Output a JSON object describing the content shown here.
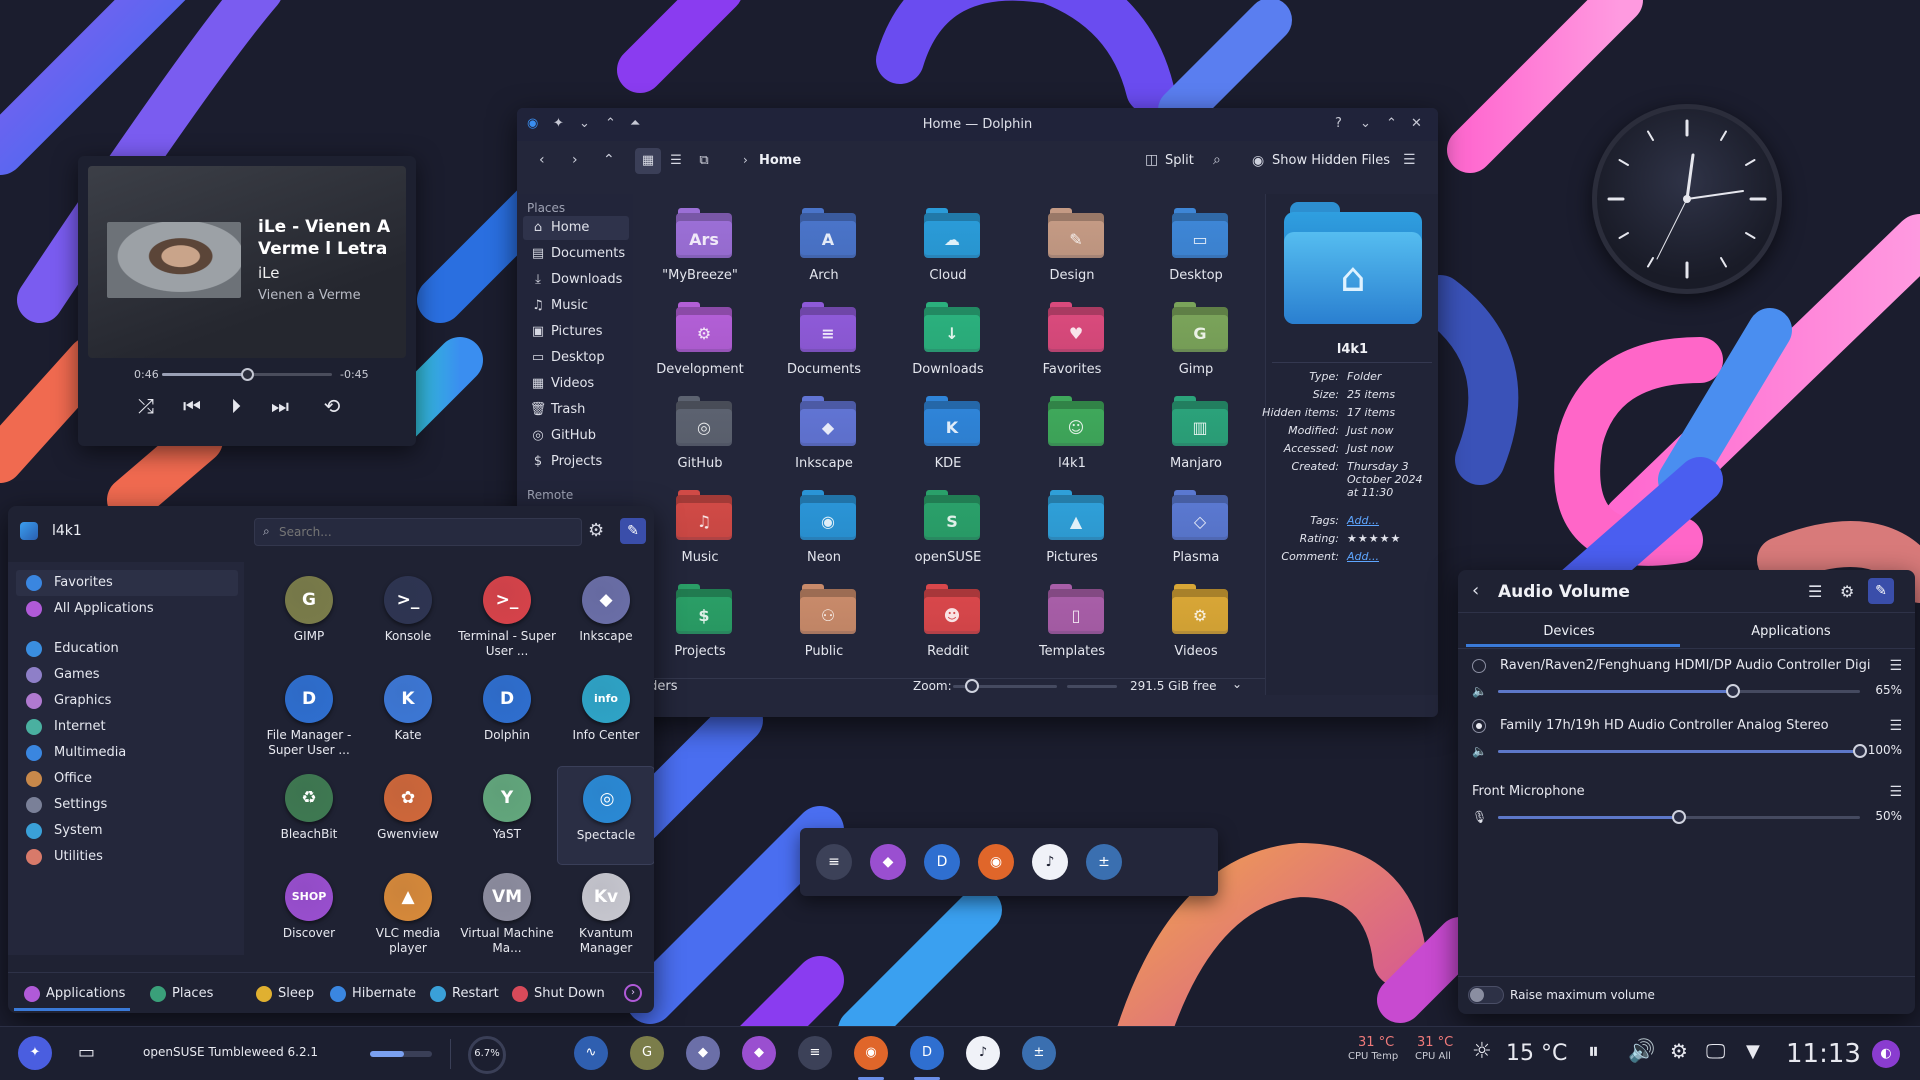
{
  "media_player": {
    "title": "iLe - Vienen A Verme l Letra",
    "artist": "iLe",
    "album": "Vienen a Verme",
    "elapsed": "0:46",
    "remaining": "-0:45",
    "progress": 0.5,
    "controls": [
      "shuffle-icon",
      "previous-icon",
      "play-icon",
      "next-icon",
      "repeat-icon"
    ]
  },
  "dolphin": {
    "window_title": "Home — Dolphin",
    "breadcrumb": "Home",
    "split_label": "Split",
    "show_hidden_label": "Show Hidden Files",
    "places_header": "Places",
    "remote_header": "Remote",
    "places": [
      {
        "label": "Home",
        "icon": "home-icon"
      },
      {
        "label": "Documents",
        "icon": "document-icon"
      },
      {
        "label": "Downloads",
        "icon": "download-icon"
      },
      {
        "label": "Music",
        "icon": "music-icon"
      },
      {
        "label": "Pictures",
        "icon": "picture-icon"
      },
      {
        "label": "Desktop",
        "icon": "desktop-icon"
      },
      {
        "label": "Videos",
        "icon": "video-icon"
      },
      {
        "label": "Trash",
        "icon": "trash-icon"
      },
      {
        "label": "GitHub",
        "icon": "github-icon"
      },
      {
        "label": "Projects",
        "icon": "dollar-icon"
      }
    ],
    "folders": [
      {
        "name": "\"MyBreeze\"",
        "color": "#9b6fd6",
        "glyph": "Ars"
      },
      {
        "name": "Arch",
        "color": "#4a74c9",
        "glyph": "A"
      },
      {
        "name": "Cloud",
        "color": "#2a9bd8",
        "glyph": "☁"
      },
      {
        "name": "Design",
        "color": "#c49a84",
        "glyph": "✎"
      },
      {
        "name": "Desktop",
        "color": "#3e86d6",
        "glyph": "▭"
      },
      {
        "name": "Development",
        "color": "#b25fd6",
        "glyph": "⚙"
      },
      {
        "name": "Documents",
        "color": "#8e5ad8",
        "glyph": "≡"
      },
      {
        "name": "Downloads",
        "color": "#2bb07d",
        "glyph": "↓"
      },
      {
        "name": "Favorites",
        "color": "#d94a7c",
        "glyph": "♥"
      },
      {
        "name": "Gimp",
        "color": "#7aa35a",
        "glyph": "G"
      },
      {
        "name": "GitHub",
        "color": "#5c6270",
        "glyph": "◎"
      },
      {
        "name": "Inkscape",
        "color": "#6174d3",
        "glyph": "◆"
      },
      {
        "name": "KDE",
        "color": "#2f84d8",
        "glyph": "K"
      },
      {
        "name": "l4k1",
        "color": "#3fa85b",
        "glyph": "☺"
      },
      {
        "name": "Manjaro",
        "color": "#2ba27a",
        "glyph": "▥"
      },
      {
        "name": "Music",
        "color": "#d04a46",
        "glyph": "♫"
      },
      {
        "name": "Neon",
        "color": "#2a94d6",
        "glyph": "◉"
      },
      {
        "name": "openSUSE",
        "color": "#2aa06a",
        "glyph": "S"
      },
      {
        "name": "Pictures",
        "color": "#2f9fd8",
        "glyph": "▲"
      },
      {
        "name": "Plasma",
        "color": "#5a78d0",
        "glyph": "◇"
      },
      {
        "name": "Projects",
        "color": "#2a9e66",
        "glyph": "$"
      },
      {
        "name": "Public",
        "color": "#c88a6a",
        "glyph": "⚇"
      },
      {
        "name": "Reddit",
        "color": "#d8474b",
        "glyph": "☻"
      },
      {
        "name": "Templates",
        "color": "#a85ea8",
        "glyph": "▯"
      },
      {
        "name": "Videos",
        "color": "#d8a636",
        "glyph": "⚙"
      }
    ],
    "status": {
      "folders": "folders",
      "zoom_label": "Zoom:",
      "zoom_level": 0.18,
      "free_space": "291.5 GiB free"
    },
    "info_panel": {
      "name": "l4k1",
      "rows": [
        {
          "key": "Type:",
          "value": "Folder"
        },
        {
          "key": "Size:",
          "value": "25 items"
        },
        {
          "key": "Hidden items:",
          "value": "17 items"
        },
        {
          "key": "Modified:",
          "value": "Just now"
        },
        {
          "key": "Accessed:",
          "value": "Just now"
        },
        {
          "key": "Created:",
          "value": "Thursday 3 October 2024 at 11:30"
        },
        {
          "key": "Tags:",
          "value": "Add..."
        },
        {
          "key": "Rating:",
          "value": "★★★★★"
        },
        {
          "key": "Comment:",
          "value": "Add..."
        }
      ]
    }
  },
  "launcher": {
    "user": "l4k1",
    "search_placeholder": "Search...",
    "categories": [
      {
        "label": "Favorites",
        "color": "#3a86e0"
      },
      {
        "label": "All Applications",
        "color": "#b05ad8"
      },
      {
        "label": "Education",
        "color": "#3a8ee0"
      },
      {
        "label": "Games",
        "color": "#8e7fc8"
      },
      {
        "label": "Graphics",
        "color": "#b07ad0"
      },
      {
        "label": "Internet",
        "color": "#4ab0a0"
      },
      {
        "label": "Multimedia",
        "color": "#3a86e0"
      },
      {
        "label": "Office",
        "color": "#c8884a"
      },
      {
        "label": "Settings",
        "color": "#7a8098"
      },
      {
        "label": "System",
        "color": "#3aa0d8"
      },
      {
        "label": "Utilities",
        "color": "#d87a6a"
      }
    ],
    "apps": [
      {
        "name": "GIMP",
        "color": "#7b7d4a",
        "glyph": "G"
      },
      {
        "name": "Konsole",
        "color": "#2e3552",
        "glyph": ">_"
      },
      {
        "name": "Terminal - Super User ...",
        "color": "#d8434a",
        "glyph": ">_"
      },
      {
        "name": "Inkscape",
        "color": "#6b6fa8",
        "glyph": "◆"
      },
      {
        "name": "File Manager - Super User ...",
        "color": "#2f6fd0",
        "glyph": "D"
      },
      {
        "name": "Kate",
        "color": "#3d78d6",
        "glyph": "K"
      },
      {
        "name": "Dolphin",
        "color": "#2f6fd0",
        "glyph": "D"
      },
      {
        "name": "Info Center",
        "color": "#2fa5c8",
        "glyph": "info"
      },
      {
        "name": "BleachBit",
        "color": "#3f7a52",
        "glyph": "♻"
      },
      {
        "name": "Gwenview",
        "color": "#d0683a",
        "glyph": "✿"
      },
      {
        "name": "YaST",
        "color": "#63a87d",
        "glyph": "Y"
      },
      {
        "name": "Spectacle",
        "color": "#2a8ad6",
        "glyph": "◎"
      },
      {
        "name": "Discover",
        "color": "#9a4fd0",
        "glyph": "SHOP"
      },
      {
        "name": "VLC media player",
        "color": "#d88a3a",
        "glyph": "▲"
      },
      {
        "name": "Virtual Machine Ma...",
        "color": "#8e8ea0",
        "glyph": "VM"
      },
      {
        "name": "Kvantum Manager",
        "color": "#c8c8d0",
        "glyph": "Kv"
      }
    ],
    "bottom": [
      {
        "label": "Applications",
        "color": "#b05ad8"
      },
      {
        "label": "Places",
        "color": "#3aa07a"
      },
      {
        "label": "Sleep",
        "color": "#e0b030"
      },
      {
        "label": "Hibernate",
        "color": "#3a86e0"
      },
      {
        "label": "Restart",
        "color": "#3aa0d8"
      },
      {
        "label": "Shut Down",
        "color": "#d84a5a"
      }
    ]
  },
  "dock": {
    "items": [
      {
        "name": "mixer-icon",
        "color": "#3c4158"
      },
      {
        "name": "discover-icon",
        "color": "#9a4fd0"
      },
      {
        "name": "dolphin-icon",
        "color": "#2f6fd0"
      },
      {
        "name": "firefox-icon",
        "color": "#e0662a"
      },
      {
        "name": "music-icon",
        "color": "#f0f2f8"
      },
      {
        "name": "calculator-icon",
        "color": "#3a6fb0"
      }
    ]
  },
  "audio": {
    "title": "Audio Volume",
    "tabs": [
      "Devices",
      "Applications"
    ],
    "devices": [
      {
        "name": "Raven/Raven2/Fenghuang HDMI/DP Audio Controller Digita...",
        "percent": "65%",
        "level": 0.65,
        "selected": false
      },
      {
        "name": "Family 17h/19h HD Audio Controller Analog Stereo",
        "percent": "100%",
        "level": 1.0,
        "selected": true
      }
    ],
    "mic": {
      "name": "Front Microphone",
      "percent": "50%",
      "level": 0.5
    },
    "raise_max_label": "Raise maximum volume"
  },
  "taskbar": {
    "os_label": "openSUSE Tumbleweed 6.2.1",
    "cpu_percent": "6.7%",
    "cpu_temp": "31 °C",
    "cpu_temp_label": "CPU Temp",
    "cpu_all": "31 °C",
    "cpu_all_label": "CPU All",
    "weather": "15 °C",
    "time": "11:13",
    "apps": [
      {
        "name": "system-monitor-icon",
        "color": "#2f5fb0"
      },
      {
        "name": "gimp-icon",
        "color": "#7b7d4a"
      },
      {
        "name": "inkscape-icon",
        "color": "#6b6fa8"
      },
      {
        "name": "discover-icon",
        "color": "#9a4fd0"
      },
      {
        "name": "mixer-icon",
        "color": "#3c4158"
      },
      {
        "name": "firefox-icon",
        "color": "#e0662a"
      },
      {
        "name": "dolphin-icon",
        "color": "#2f6fd0"
      },
      {
        "name": "music-icon",
        "color": "#f0f2f8"
      },
      {
        "name": "calculator-icon",
        "color": "#3a6fb0"
      }
    ]
  }
}
